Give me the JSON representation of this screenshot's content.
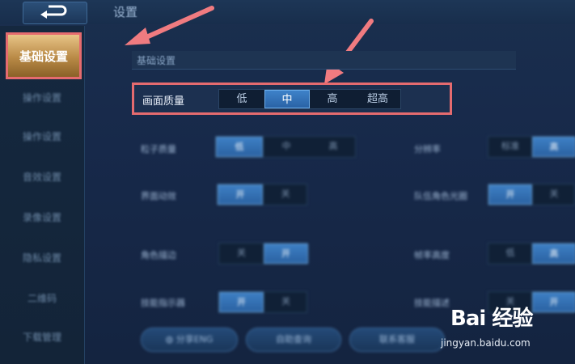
{
  "header": {
    "title": "设置"
  },
  "sidebar": {
    "active_label": "基础设置",
    "items": [
      {
        "label": "操作设置"
      },
      {
        "label": "操作设置"
      },
      {
        "label": "音效设置"
      },
      {
        "label": "录像设置"
      },
      {
        "label": "隐私设置"
      },
      {
        "label": "二维码"
      },
      {
        "label": "下载管理"
      }
    ]
  },
  "main": {
    "section_title": "基础设置",
    "quality": {
      "label": "画面质量",
      "options": [
        "低",
        "中",
        "高",
        "超高"
      ],
      "selected": "中"
    },
    "left_rows": [
      {
        "label": "粒子质量",
        "options": [
          "低",
          "中",
          "高"
        ],
        "selected_index": 0
      },
      {
        "label": "界面动效",
        "options": [
          "开",
          "关"
        ],
        "selected_index": 0
      },
      {
        "label": "角色描边",
        "options": [
          "关",
          "开"
        ],
        "selected_index": 1
      },
      {
        "label": "技能指示器",
        "options": [
          "开",
          "关"
        ],
        "selected_index": 0
      }
    ],
    "right_rows": [
      {
        "label": "分辨率",
        "options": [
          "标准",
          "高"
        ],
        "selected_index": 1
      },
      {
        "label": "队伍角色光圈",
        "options": [
          "开",
          "关"
        ],
        "selected_index": 0
      },
      {
        "label": "帧率高度",
        "options": [
          "低",
          "高"
        ],
        "selected_index": 1
      },
      {
        "label": "技能描述",
        "options": [
          "关",
          "开"
        ],
        "selected_index": 1
      }
    ],
    "bottom_buttons": [
      "分享ENG",
      "自助查询",
      "联系客服"
    ]
  },
  "watermark": {
    "text": "Bai 经验",
    "url": "jingyan.baidu.com"
  },
  "colors": {
    "highlight": "#e56b6f",
    "accent": "#3e82c9",
    "gold": "#d0a35e"
  }
}
